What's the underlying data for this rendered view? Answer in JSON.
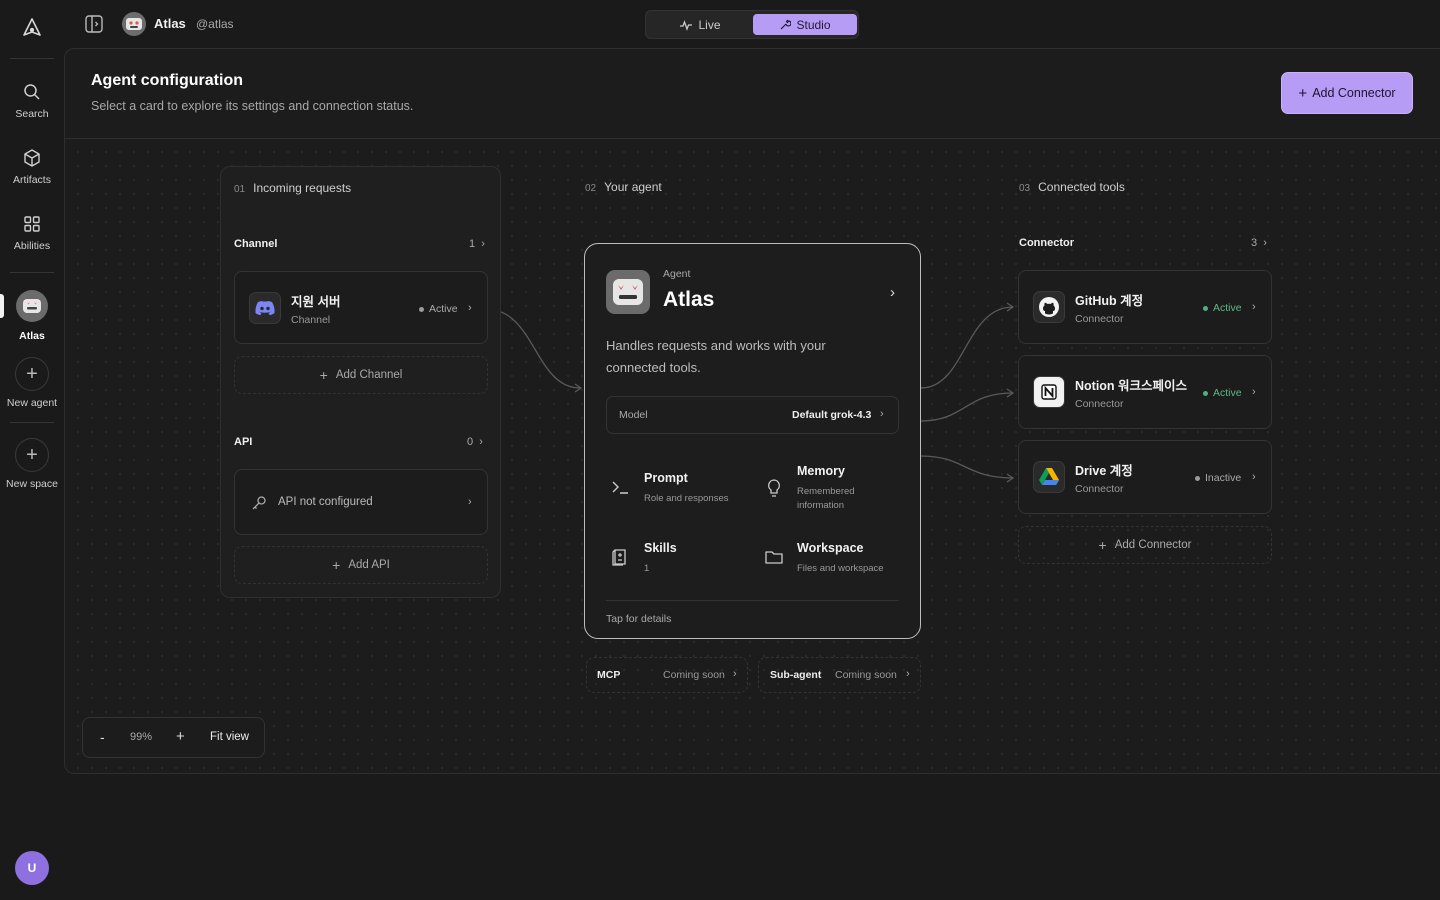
{
  "rail": {
    "items": [
      {
        "label": "Search",
        "icon": "search-icon"
      },
      {
        "label": "Artifacts",
        "icon": "cube-icon"
      },
      {
        "label": "Abilities",
        "icon": "grid-icon"
      },
      {
        "label": "Atlas",
        "icon": "robot-avatar-icon"
      },
      {
        "label": "New agent",
        "icon": "plus-icon"
      },
      {
        "label": "New space",
        "icon": "plus-icon"
      }
    ],
    "user_initial": "U"
  },
  "topbar": {
    "agent_name": "Atlas",
    "handle": "@atlas",
    "modes": [
      "Live",
      "Studio"
    ],
    "active_mode": "Studio"
  },
  "header": {
    "title": "Agent configuration",
    "subtitle": "Select a card to explore its settings and connection status.",
    "add_button": "Add Connector"
  },
  "incoming": {
    "num": "01",
    "label": "Incoming requests",
    "channel_title": "Channel",
    "channel_count": "1",
    "channel": {
      "name": "지원 서버",
      "type": "Channel",
      "status": "Active"
    },
    "add_channel": "Add Channel",
    "api_title": "API",
    "api_count": "0",
    "api_empty": "API not configured",
    "add_api": "Add API"
  },
  "agent": {
    "num": "02",
    "label": "Your agent",
    "kicker": "Agent",
    "name": "Atlas",
    "description": "Handles requests and works with your connected tools.",
    "model_label": "Model",
    "model_value": "Default grok-4.3",
    "features": [
      {
        "name": "Prompt",
        "sub": "Role and responses",
        "icon": "terminal-icon"
      },
      {
        "name": "Memory",
        "sub": "Remembered information",
        "icon": "bulb-icon"
      },
      {
        "name": "Skills",
        "sub": "1",
        "icon": "skills-icon"
      },
      {
        "name": "Workspace",
        "sub": "Files and workspace",
        "icon": "folder-icon"
      }
    ],
    "footer": "Tap for details",
    "extras": [
      {
        "name": "MCP",
        "status": "Coming soon"
      },
      {
        "name": "Sub-agent",
        "status": "Coming soon"
      }
    ]
  },
  "tools": {
    "num": "03",
    "label": "Connected tools",
    "section_title": "Connector",
    "count": "3",
    "connectors": [
      {
        "name": "GitHub 계정",
        "type": "Connector",
        "status": "Active",
        "icon": "github-icon"
      },
      {
        "name": "Notion 워크스페이스",
        "type": "Connector",
        "status": "Active",
        "icon": "notion-icon"
      },
      {
        "name": "Drive 계정",
        "type": "Connector",
        "status": "Inactive",
        "icon": "drive-icon"
      }
    ],
    "add_connector": "Add Connector"
  },
  "zoom": {
    "minus": "-",
    "level": "99%",
    "plus": "+",
    "fit": "Fit view"
  },
  "colors": {
    "accent": "#b79cf5",
    "active": "#4fb07e",
    "background": "#1a1a1a"
  }
}
